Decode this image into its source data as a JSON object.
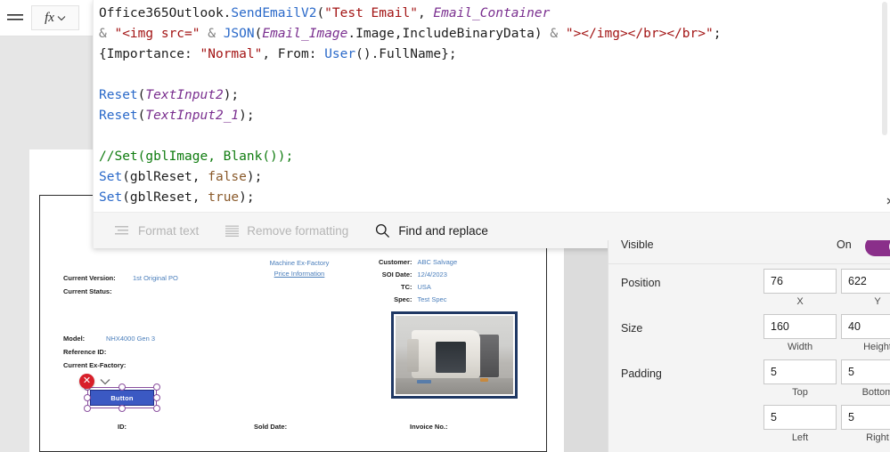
{
  "app": {
    "background_color": "#e6e6e6",
    "accent_color": "#8a2f8a"
  },
  "formula_bar": {
    "hamburger_icon": "hamburger-menu-icon",
    "fx_label": "fx",
    "fx_chevron_icon": "chevron-down-icon",
    "code_lines": [
      [
        {
          "t": "Office365Outlook.",
          "c": "c-id"
        },
        {
          "t": "SendEmailV2",
          "c": "c-fn"
        },
        {
          "t": "(",
          "c": "c-plain"
        },
        {
          "t": "\"Test Email\"",
          "c": "c-str"
        },
        {
          "t": ", ",
          "c": "c-plain"
        },
        {
          "t": "Email_Container",
          "c": "c-var"
        }
      ],
      [
        {
          "t": "& ",
          "c": "c-op"
        },
        {
          "t": "\"<img src=\"",
          "c": "c-str"
        },
        {
          "t": " & ",
          "c": "c-op"
        },
        {
          "t": "JSON",
          "c": "c-fn"
        },
        {
          "t": "(",
          "c": "c-plain"
        },
        {
          "t": "Email_Image",
          "c": "c-var"
        },
        {
          "t": ".Image,IncludeBinaryData)",
          "c": "c-plain"
        },
        {
          "t": " & ",
          "c": "c-op"
        },
        {
          "t": "\"></img></br></br>\"",
          "c": "c-str"
        },
        {
          "t": ";",
          "c": "c-plain"
        }
      ],
      [
        {
          "t": "{Importance: ",
          "c": "c-plain"
        },
        {
          "t": "\"Normal\"",
          "c": "c-str"
        },
        {
          "t": ", From: ",
          "c": "c-plain"
        },
        {
          "t": "User",
          "c": "c-fn"
        },
        {
          "t": "().FullName};",
          "c": "c-plain"
        }
      ],
      [],
      [
        {
          "t": "Reset",
          "c": "c-fn"
        },
        {
          "t": "(",
          "c": "c-plain"
        },
        {
          "t": "TextInput2",
          "c": "c-var"
        },
        {
          "t": ");",
          "c": "c-plain"
        }
      ],
      [
        {
          "t": "Reset",
          "c": "c-fn"
        },
        {
          "t": "(",
          "c": "c-plain"
        },
        {
          "t": "TextInput2_1",
          "c": "c-var"
        },
        {
          "t": ");",
          "c": "c-plain"
        }
      ],
      [],
      [
        {
          "t": "//Set(gblImage, Blank());",
          "c": "c-cmt"
        }
      ],
      [
        {
          "t": "Set",
          "c": "c-fn"
        },
        {
          "t": "(gblReset, ",
          "c": "c-plain"
        },
        {
          "t": "false",
          "c": "c-kw"
        },
        {
          "t": ");",
          "c": "c-plain"
        }
      ],
      [
        {
          "t": "Set",
          "c": "c-fn"
        },
        {
          "t": "(gblReset, ",
          "c": "c-plain"
        },
        {
          "t": "true",
          "c": "c-kw"
        },
        {
          "t": ");",
          "c": "c-plain"
        }
      ]
    ],
    "tools": [
      {
        "label": "Format text",
        "icon": "format-text-icon",
        "state": "disabled"
      },
      {
        "label": "Remove formatting",
        "icon": "remove-formatting-icon",
        "state": "disabled"
      },
      {
        "label": "Find and replace",
        "icon": "search-icon",
        "state": "enabled"
      }
    ]
  },
  "canvas": {
    "form": {
      "left_fields": [
        {
          "label": "Current Version:",
          "value": "1st Original PO"
        },
        {
          "label": "Current Status:",
          "value": ""
        }
      ],
      "left_fields2": [
        {
          "label": "Model:",
          "value": "NHX4000 Gen 3"
        },
        {
          "label": "Reference ID:",
          "value": ""
        },
        {
          "label": "Current Ex-Factory:",
          "value": ""
        }
      ],
      "center_link": {
        "line1": "Machine Ex-Factory",
        "line2": "Price Information"
      },
      "right_fields": [
        {
          "label": "Customer:",
          "value": "ABC Salvage"
        },
        {
          "label": "SOI Date:",
          "value": "12/4/2023"
        },
        {
          "label": "TC:",
          "value": "USA"
        },
        {
          "label": "Spec:",
          "value": "Test Spec"
        }
      ],
      "bottom_labels": [
        "ID:",
        "Sold Date:",
        "Invoice No.:"
      ],
      "image_alt": "machine-photo"
    },
    "selected_control": {
      "label": "Button",
      "error_icon": "error-x-icon",
      "error_chevron_icon": "chevron-down-icon"
    }
  },
  "properties_panel": {
    "visible": {
      "label": "Visible",
      "value": "On"
    },
    "position": {
      "label": "Position",
      "x": "76",
      "y": "622",
      "x_sub": "X",
      "y_sub": "Y"
    },
    "size": {
      "label": "Size",
      "width": "160",
      "height": "40",
      "width_sub": "Width",
      "height_sub": "Height"
    },
    "padding": {
      "label": "Padding",
      "top": "5",
      "bottom": "5",
      "left": "5",
      "right": "5",
      "top_sub": "Top",
      "bottom_sub": "Bottom",
      "left_sub": "Left",
      "right_sub": "Right"
    }
  }
}
